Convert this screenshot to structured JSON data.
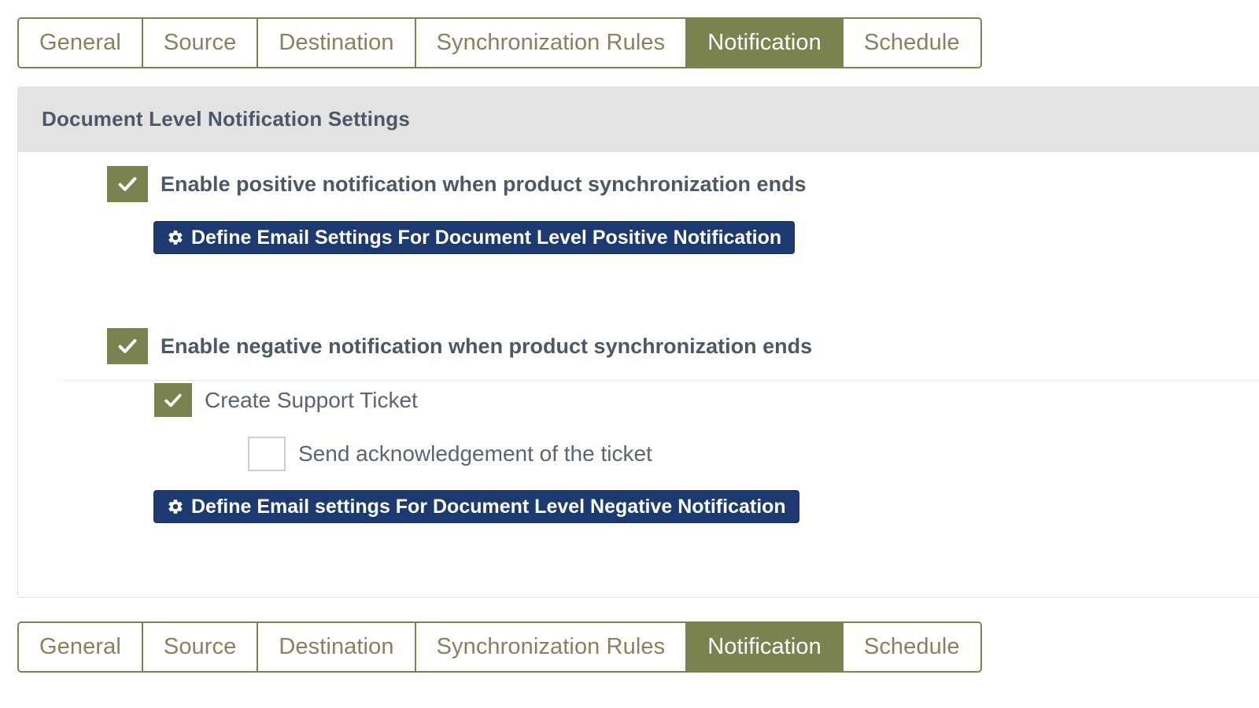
{
  "tabs": {
    "items": [
      {
        "label": "General",
        "active": false
      },
      {
        "label": "Source",
        "active": false
      },
      {
        "label": "Destination",
        "active": false
      },
      {
        "label": "Synchronization Rules",
        "active": false
      },
      {
        "label": "Notification",
        "active": true
      },
      {
        "label": "Schedule",
        "active": false
      }
    ]
  },
  "panel": {
    "title": "Document Level Notification Settings"
  },
  "positive_section": {
    "checkbox": {
      "label": "Enable positive notification when product synchronization ends",
      "checked": true,
      "state": "checked"
    },
    "button": {
      "label": "Define Email Settings For Document Level Positive Notification",
      "icon": "gear-icon"
    }
  },
  "negative_section": {
    "checkbox": {
      "label": "Enable negative notification when product synchronization ends",
      "checked": true,
      "state": "checked"
    },
    "create_ticket": {
      "label": "Create Support Ticket",
      "checked": true,
      "state": "checked"
    },
    "send_ack": {
      "label": "Send acknowledgement of the ticket",
      "checked": false,
      "state": "unchecked"
    },
    "button": {
      "label": "Define Email settings For Document Level Negative Notification",
      "icon": "gear-icon"
    }
  },
  "colors": {
    "accent_olive": "#7c8150",
    "button_navy": "#1c3a70",
    "header_gray": "#e3e3e3",
    "text_slate": "#4c5866",
    "tab_text": "#8a7f5e",
    "checkbox_border": "#cfcfc9"
  }
}
